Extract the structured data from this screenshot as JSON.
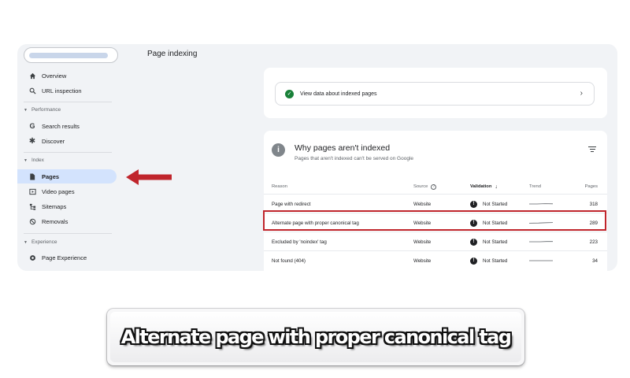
{
  "header": {
    "title": "Page indexing"
  },
  "sidebar": {
    "items": [
      {
        "label": "Overview",
        "icon": "home-icon"
      },
      {
        "label": "URL inspection",
        "icon": "search-icon"
      }
    ],
    "sections": [
      {
        "label": "Performance",
        "items": [
          {
            "label": "Search results",
            "icon": "google-g-icon"
          },
          {
            "label": "Discover",
            "icon": "asterisk-icon"
          }
        ]
      },
      {
        "label": "Index",
        "items": [
          {
            "label": "Pages",
            "icon": "pages-icon",
            "active": true
          },
          {
            "label": "Video pages",
            "icon": "video-icon"
          },
          {
            "label": "Sitemaps",
            "icon": "sitemap-icon"
          },
          {
            "label": "Removals",
            "icon": "removals-icon"
          }
        ]
      },
      {
        "label": "Experience",
        "items": [
          {
            "label": "Page Experience",
            "icon": "gear-icon"
          }
        ]
      }
    ]
  },
  "indexed_card": {
    "link_label": "View data about indexed pages",
    "chevron": "›"
  },
  "not_indexed": {
    "title": "Why pages aren't indexed",
    "subtitle": "Pages that aren't indexed can't be served on Google",
    "columns": {
      "reason": "Reason",
      "source": "Source",
      "validation": "Validation",
      "trend": "Trend",
      "pages": "Pages"
    },
    "rows": [
      {
        "reason": "Page with redirect",
        "source": "Website",
        "validation": "Not Started",
        "pages": "318"
      },
      {
        "reason": "Alternate page with proper canonical tag",
        "source": "Website",
        "validation": "Not Started",
        "pages": "289"
      },
      {
        "reason": "Excluded by 'noindex' tag",
        "source": "Website",
        "validation": "Not Started",
        "pages": "223"
      },
      {
        "reason": "Not found (404)",
        "source": "Website",
        "validation": "Not Started",
        "pages": "34"
      }
    ]
  },
  "caption": {
    "text": "Alternate page with proper canonical tag"
  },
  "colors": {
    "highlight": "#c0252c",
    "active_nav": "#d3e3fd",
    "check_green": "#188038"
  }
}
